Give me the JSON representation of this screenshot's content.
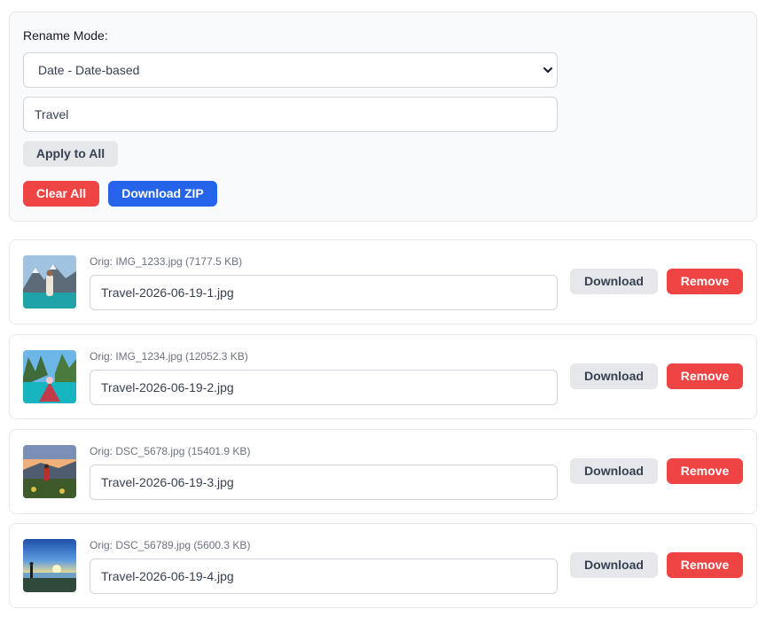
{
  "controls": {
    "rename_label": "Rename Mode:",
    "mode_selected": "Date - Date-based",
    "prefix_value": "Travel",
    "apply_all_label": "Apply to All",
    "clear_all_label": "Clear All",
    "download_zip_label": "Download ZIP"
  },
  "files": [
    {
      "orig": "Orig: IMG_1233.jpg (7177.5 KB)",
      "new_name": "Travel-2026-06-19-1.jpg",
      "download_label": "Download",
      "remove_label": "Remove"
    },
    {
      "orig": "Orig: IMG_1234.jpg (12052.3 KB)",
      "new_name": "Travel-2026-06-19-2.jpg",
      "download_label": "Download",
      "remove_label": "Remove"
    },
    {
      "orig": "Orig: DSC_5678.jpg (15401.9 KB)",
      "new_name": "Travel-2026-06-19-3.jpg",
      "download_label": "Download",
      "remove_label": "Remove"
    },
    {
      "orig": "Orig: DSC_56789.jpg (5600.3 KB)",
      "new_name": "Travel-2026-06-19-4.jpg",
      "download_label": "Download",
      "remove_label": "Remove"
    }
  ],
  "colors": {
    "danger": "#ef4444",
    "primary": "#2563eb",
    "neutral_button": "#e5e7eb"
  }
}
